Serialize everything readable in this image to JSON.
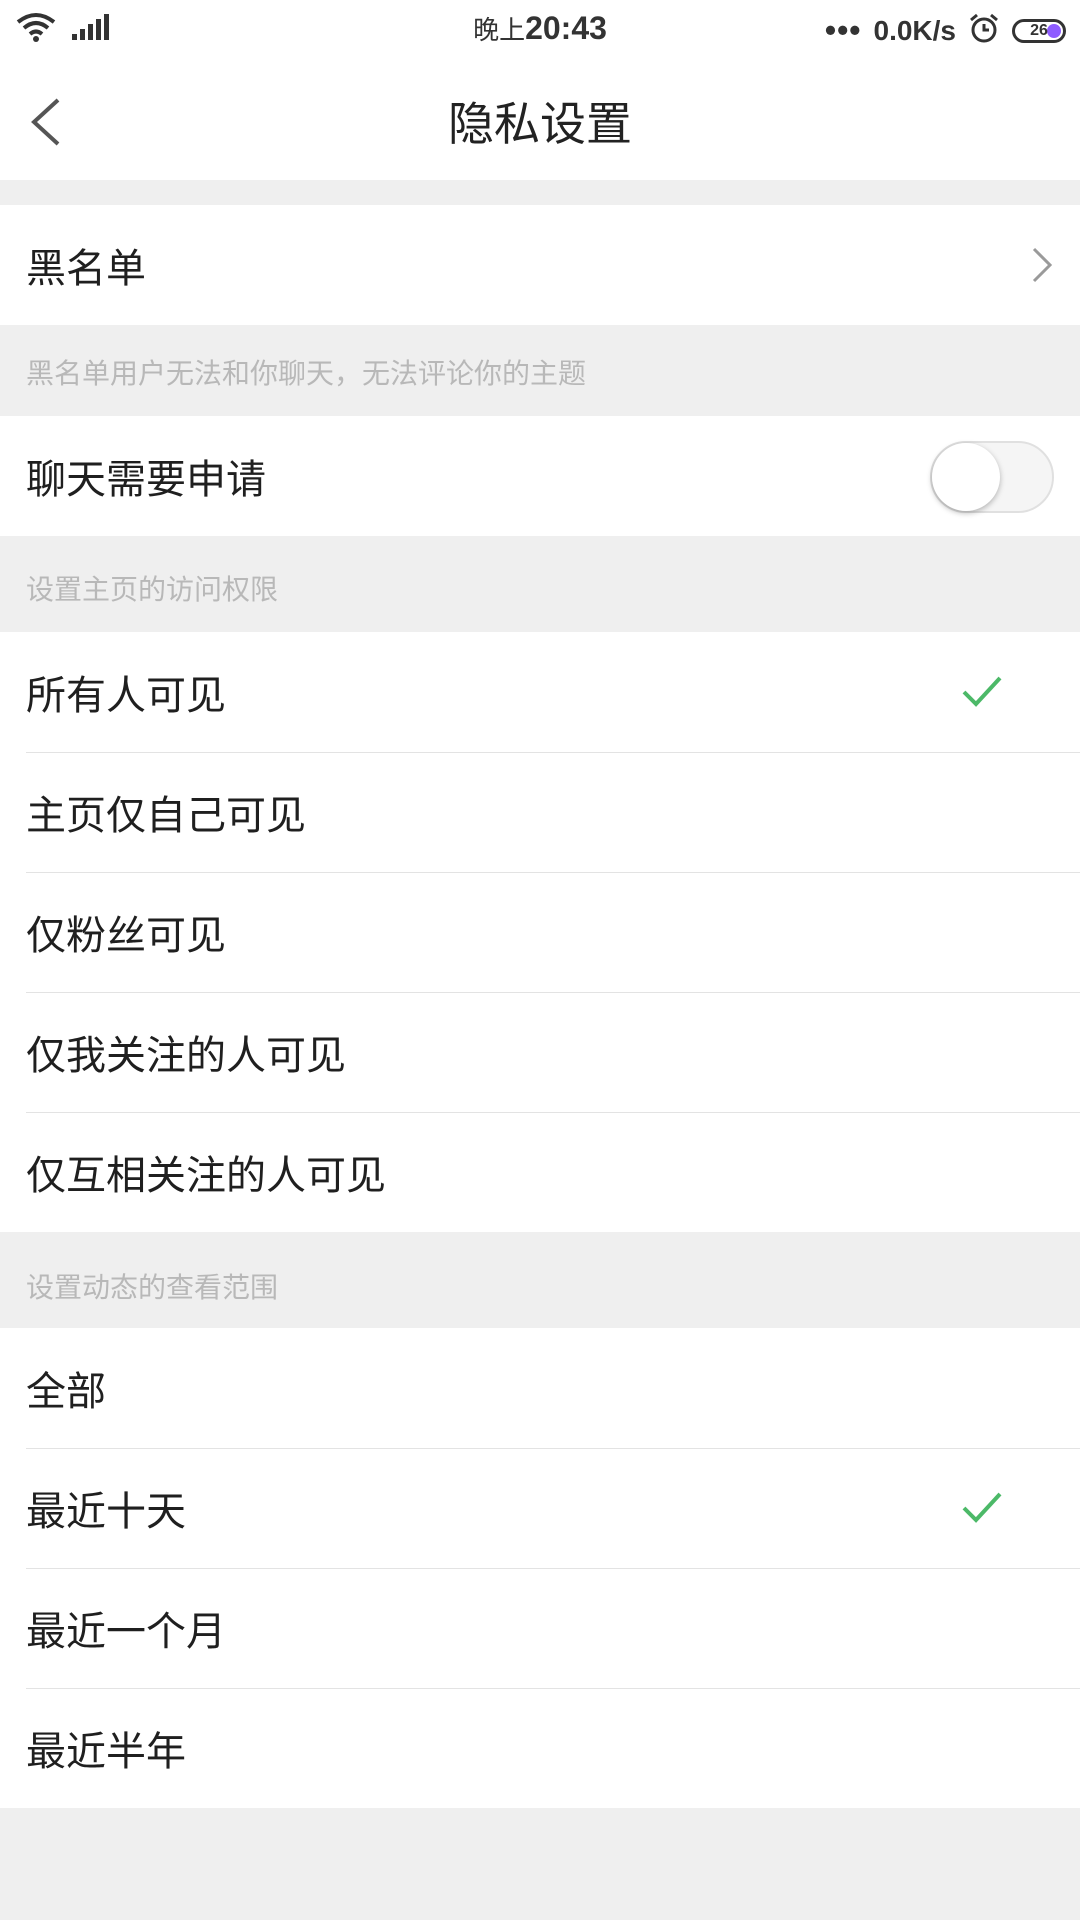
{
  "status_bar": {
    "time_prefix": "晚上",
    "time": "20:43",
    "dots": "•••",
    "net_speed": "0.0K/s",
    "battery": "26"
  },
  "header": {
    "title": "隐私设置"
  },
  "blacklist": {
    "label": "黑名单",
    "note": "黑名单用户无法和你聊天，无法评论你的主题"
  },
  "chat_request": {
    "label": "聊天需要申请",
    "enabled": false
  },
  "homepage_access": {
    "note": "设置主页的访问权限",
    "options": [
      {
        "label": "所有人可见",
        "selected": true
      },
      {
        "label": "主页仅自己可见",
        "selected": false
      },
      {
        "label": "仅粉丝可见",
        "selected": false
      },
      {
        "label": "仅我关注的人可见",
        "selected": false
      },
      {
        "label": "仅互相关注的人可见",
        "selected": false
      }
    ]
  },
  "feed_range": {
    "note": "设置动态的查看范围",
    "options": [
      {
        "label": "全部",
        "selected": false
      },
      {
        "label": "最近十天",
        "selected": true
      },
      {
        "label": "最近一个月",
        "selected": false
      },
      {
        "label": "最近半年",
        "selected": false
      }
    ]
  },
  "colors": {
    "check": "#4cb968",
    "background": "#efefef",
    "hint": "#b8b8b8"
  }
}
